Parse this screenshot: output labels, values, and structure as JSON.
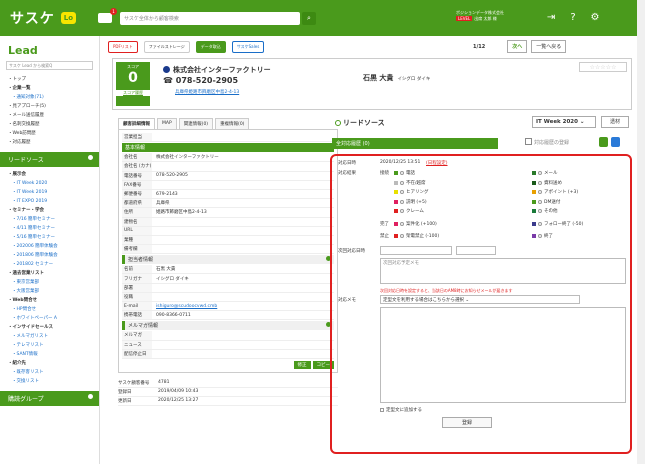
{
  "topbar": {
    "logo": "サスケ",
    "logo_badge": "Lo",
    "notif_count": "1",
    "search_placeholder": "サスケ全体から顧客検索",
    "search_icon": "magnifier-icon",
    "user_line1": "ポジションデータ株式会社",
    "user_level": "LEVEL",
    "user_line2": "出席 太郎 様",
    "icons": [
      "logout-icon",
      "help-icon",
      "gear-icon"
    ]
  },
  "sidebar": {
    "logo": "Lead",
    "search_placeholder": "サスケ Lead から検索Q",
    "items1": [
      {
        "label": "・トップ",
        "cls": ""
      },
      {
        "label": "・企業一覧",
        "cls": "bold"
      },
      {
        "label": "・通知対象(71)",
        "cls": "sub"
      },
      {
        "label": "・見アプローチ(5)",
        "cls": ""
      },
      {
        "label": "・メール送信履歴",
        "cls": ""
      },
      {
        "label": "・名刺交換履歴",
        "cls": ""
      },
      {
        "label": "・Web訪問歴",
        "cls": ""
      },
      {
        "label": "・対応履歴",
        "cls": ""
      }
    ],
    "head1": "リードソース",
    "items2": [
      {
        "label": "・展示会",
        "cls": "bold"
      },
      {
        "label": "・IT Week 2020",
        "cls": "sub"
      },
      {
        "label": "・IT Week 2019",
        "cls": "sub"
      },
      {
        "label": "・IT EXPO 2019",
        "cls": "sub"
      },
      {
        "label": "・セミナー・学会",
        "cls": "bold"
      },
      {
        "label": "・7/16 簡単セミナー",
        "cls": "sub"
      },
      {
        "label": "・4/11 簡単セミナー",
        "cls": "sub"
      },
      {
        "label": "・5/16 簡単セミナー",
        "cls": "sub"
      },
      {
        "label": "・202006 簡単体験会",
        "cls": "sub"
      },
      {
        "label": "・201806 簡単体験会",
        "cls": "sub"
      },
      {
        "label": "・201802 セミナー",
        "cls": "sub"
      },
      {
        "label": "・過去営業リスト",
        "cls": "bold"
      },
      {
        "label": "・東京営業部",
        "cls": "sub"
      },
      {
        "label": "・大阪営業部",
        "cls": "sub"
      },
      {
        "label": "・Web問合せ",
        "cls": "bold"
      },
      {
        "label": "・HP問合せ",
        "cls": "sub"
      },
      {
        "label": "・ホワイトペーパー A",
        "cls": "sub"
      },
      {
        "label": "・インサイドセールス",
        "cls": "bold"
      },
      {
        "label": "・メルマガリスト",
        "cls": "sub"
      },
      {
        "label": "・テレマリスト",
        "cls": "sub"
      },
      {
        "label": "・SANT情報",
        "cls": "sub"
      },
      {
        "label": "・紹介先",
        "cls": "bold"
      },
      {
        "label": "・既存客リスト",
        "cls": "sub"
      },
      {
        "label": "・交換リスト",
        "cls": "sub"
      }
    ],
    "head2": "購読グループ"
  },
  "main": {
    "tabs": [
      {
        "label": "PDFリスト",
        "cls": "red"
      },
      {
        "label": "ファイルストレージ",
        "cls": ""
      },
      {
        "label": "データ取込",
        "cls": "green"
      },
      {
        "label": "サスケSales",
        "cls": "blue"
      }
    ],
    "page": "1/12",
    "next": "次へ",
    "back": "一覧へ戻る",
    "score_label": "スコア",
    "score": "0",
    "score_link": "スコア履歴",
    "company": "株式会社インターファクトリー",
    "phone": "078-520-2905",
    "address": "兵庫県姫路市飾磨区中島2-4-13",
    "person": "石黒 大貴",
    "person_kana": "イシグロ ダイキ",
    "stars": "☆☆☆☆☆",
    "left_tabs": [
      "顧客詳細情報",
      "MAP",
      "関連情報(0)",
      "重複情報(0)"
    ],
    "top_rows": [
      {
        "k": "営業担当",
        "v": ""
      }
    ],
    "sec_basic": "基本情報",
    "basic_rows": [
      {
        "k": "会社名",
        "v": "株式会社インターファクトリー"
      },
      {
        "k": "会社名 (カナ)",
        "v": ""
      },
      {
        "k": "電話番号",
        "v": "078-520-2905"
      },
      {
        "k": "FAX番号",
        "v": ""
      },
      {
        "k": "郵便番号",
        "v": "679-2143"
      },
      {
        "k": "都道府県",
        "v": "兵庫県"
      },
      {
        "k": "住所",
        "v": "姫路市飾磨区中島2-4-13"
      },
      {
        "k": "建物名",
        "v": ""
      },
      {
        "k": "URL",
        "v": ""
      },
      {
        "k": "業種",
        "v": ""
      },
      {
        "k": "備考欄",
        "v": ""
      }
    ],
    "sec_person": "担当者情報",
    "person_rows": [
      {
        "k": "名前",
        "v": "石黒 大貴"
      },
      {
        "k": "フリガナ",
        "v": "イシグロ ダイキ"
      },
      {
        "k": "部署",
        "v": ""
      },
      {
        "k": "役職",
        "v": ""
      },
      {
        "k": "E-mail",
        "v": "ishiguro@scudoocvwd.cmb"
      },
      {
        "k": "携帯電話",
        "v": "090-8366-0711"
      }
    ],
    "sec_mail": "メルマガ情報",
    "mail_rows": [
      {
        "k": "メルマガ",
        "v": ""
      },
      {
        "k": "ニュース",
        "v": ""
      },
      {
        "k": "配信停止日",
        "v": ""
      }
    ],
    "edit_btn": "修正",
    "copy_btn": "コピー",
    "meta": [
      {
        "k": "サスケ顧客番号",
        "v": "4781"
      },
      {
        "k": "登録日",
        "v": "2019/04/09 10:43"
      },
      {
        "k": "更新日",
        "v": "2020/12/25 13:27"
      }
    ]
  },
  "lead": {
    "title": "リードソース",
    "week": "IT Week 2020",
    "transfer": "透材",
    "history": "全対応履歴 (0)",
    "reg_link": "対応履歴の登録",
    "date_label": "対応日時",
    "date": "2020/12/25 13:51",
    "date_change": "(日程設定)",
    "result_label": "対応結果",
    "cat1": "接続",
    "cat2": "完了",
    "cat3": "禁止",
    "opts_left": [
      "電話",
      "不在/越席",
      "ヒアリング",
      "説明 (+5)",
      "クレーム"
    ],
    "opts_right": [
      "メール",
      "資料送め",
      "アポイント (+3)",
      "DM送付",
      "その他"
    ],
    "opt_done1": "案件化 (+100)",
    "opt_done2": "フォロー終了 (-50)",
    "opt_ban1": "架電禁止 (-100)",
    "opt_ban2": "終了",
    "next_label": "次回対応日時",
    "next_memo_ph": "次回対応予定メモ",
    "next_note": "次回対応日時を設定すると、当該日のAM8時にお知らせメールが届きます",
    "memo_label": "対応メモ",
    "memo_select": "定型文を利用する場合はこちらから選択",
    "memo_check": "定型文に追加する",
    "submit": "登録"
  }
}
